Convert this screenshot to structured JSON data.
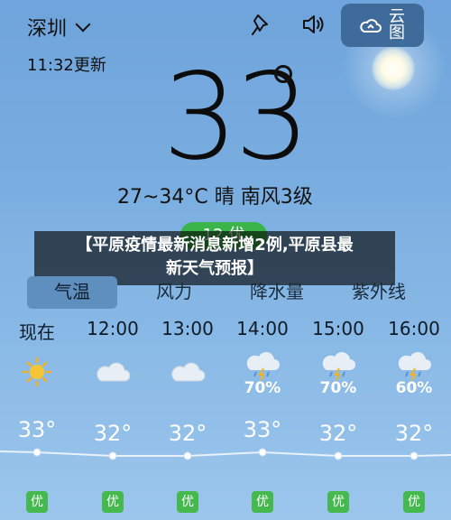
{
  "header": {
    "city": "深圳",
    "updated": "11:32更新",
    "cloud_button_label": "云图",
    "share_icon": "pin-icon",
    "sound_icon": "speaker-icon"
  },
  "current": {
    "temperature": "33",
    "summary": "27~34°C  晴  南风3级",
    "aqi_label": "12 优"
  },
  "banner": {
    "line1": "【平原疫情最新消息新增2例,平原县最",
    "line2": "新天气预报】"
  },
  "tabs": [
    {
      "label": "气温",
      "active": true
    },
    {
      "label": "风力",
      "active": false
    },
    {
      "label": "降水量",
      "active": false
    },
    {
      "label": "紫外线",
      "active": false
    }
  ],
  "hourly": [
    {
      "time": "现在",
      "icon": "sun-icon",
      "prob": "",
      "temp": "33°",
      "aqi": "优"
    },
    {
      "time": "12:00",
      "icon": "cloud-icon",
      "prob": "",
      "temp": "32°",
      "aqi": "优"
    },
    {
      "time": "13:00",
      "icon": "cloud-icon",
      "prob": "",
      "temp": "32°",
      "aqi": "优"
    },
    {
      "time": "14:00",
      "icon": "thunder-rain-icon",
      "prob": "70%",
      "temp": "33°",
      "aqi": "优"
    },
    {
      "time": "15:00",
      "icon": "thunder-rain-icon",
      "prob": "70%",
      "temp": "32°",
      "aqi": "优"
    },
    {
      "time": "16:00",
      "icon": "thunder-rain-icon",
      "prob": "60%",
      "temp": "32°",
      "aqi": "优"
    }
  ],
  "colors": {
    "aqi_good": "#45b94d",
    "banner_bg": "#000000",
    "active_tab": "#5f8fbf"
  }
}
